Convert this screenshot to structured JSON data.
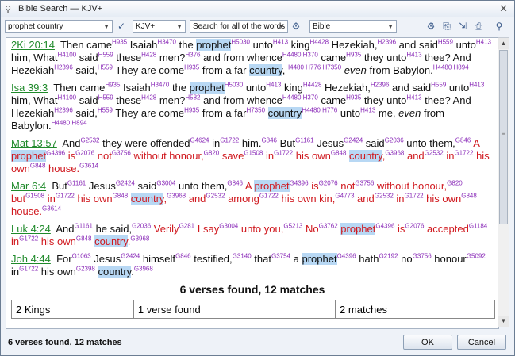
{
  "window": {
    "title": "Bible Search — KJV+",
    "title_icon": "binoculars-icon",
    "close_glyph": "✕"
  },
  "toolbar": {
    "search_value": "prophet country",
    "spell_icon": "spellcheck-icon",
    "version_value": "KJV+",
    "mode_value": "Search for all of the words",
    "options_icon": "gear-icon",
    "scope_value": "Bible"
  },
  "verses": [
    {
      "ref": "2Ki 20:14",
      "parts": [
        [
          "t",
          "Then came"
        ],
        [
          "s",
          "H935"
        ],
        [
          "t",
          " Isaiah"
        ],
        [
          "s",
          "H3470"
        ],
        [
          "t",
          " the "
        ],
        [
          "h",
          "prophet"
        ],
        [
          "s",
          "H5030"
        ],
        [
          "t",
          " unto"
        ],
        [
          "s",
          "H413"
        ],
        [
          "t",
          " king"
        ],
        [
          "s",
          "H4428"
        ],
        [
          "t",
          " Hezekiah,"
        ],
        [
          "s",
          "H2396"
        ],
        [
          "t",
          " and said"
        ],
        [
          "s",
          "H559"
        ],
        [
          "t",
          " unto"
        ],
        [
          "s",
          "H413"
        ],
        [
          "t",
          " him, What"
        ],
        [
          "s",
          "H4100"
        ],
        [
          "t",
          " said"
        ],
        [
          "s",
          "H559"
        ],
        [
          "t",
          " these"
        ],
        [
          "s",
          "H428"
        ],
        [
          "t",
          " men?"
        ],
        [
          "s",
          "H376"
        ],
        [
          "t",
          " and from whence"
        ],
        [
          "s",
          "H4480 H370"
        ],
        [
          "t",
          " came"
        ],
        [
          "s",
          "H935"
        ],
        [
          "t",
          " they unto"
        ],
        [
          "s",
          "H413"
        ],
        [
          "t",
          " thee? And Hezekiah"
        ],
        [
          "s",
          "H2396"
        ],
        [
          "t",
          " said,"
        ],
        [
          "s",
          "H559"
        ],
        [
          "t",
          " They are come"
        ],
        [
          "s",
          "H935"
        ],
        [
          "t",
          " from a far "
        ],
        [
          "h",
          "country"
        ],
        [
          "t",
          ","
        ],
        [
          "s",
          "H4480 H776 H7350"
        ],
        [
          "t",
          " "
        ],
        [
          "i",
          "even"
        ],
        [
          "t",
          " from Babylon."
        ],
        [
          "s",
          "H4480 H894"
        ]
      ]
    },
    {
      "ref": "Isa 39:3",
      "parts": [
        [
          "t",
          "Then came"
        ],
        [
          "s",
          "H935"
        ],
        [
          "t",
          " Isaiah"
        ],
        [
          "s",
          "H3470"
        ],
        [
          "t",
          " the "
        ],
        [
          "h",
          "prophet"
        ],
        [
          "s",
          "H5030"
        ],
        [
          "t",
          " unto"
        ],
        [
          "s",
          "H413"
        ],
        [
          "t",
          " king"
        ],
        [
          "s",
          "H4428"
        ],
        [
          "t",
          " Hezekiah,"
        ],
        [
          "s",
          "H2396"
        ],
        [
          "t",
          " and said"
        ],
        [
          "s",
          "H559"
        ],
        [
          "t",
          " unto"
        ],
        [
          "s",
          "H413"
        ],
        [
          "t",
          " him, What"
        ],
        [
          "s",
          "H4100"
        ],
        [
          "t",
          " said"
        ],
        [
          "s",
          "H559"
        ],
        [
          "t",
          " these"
        ],
        [
          "s",
          "H428"
        ],
        [
          "t",
          " men?"
        ],
        [
          "s",
          "H582"
        ],
        [
          "t",
          " and from whence"
        ],
        [
          "s",
          "H4480 H370"
        ],
        [
          "t",
          " came"
        ],
        [
          "s",
          "H935"
        ],
        [
          "t",
          " they unto"
        ],
        [
          "s",
          "H413"
        ],
        [
          "t",
          " thee? And Hezekiah"
        ],
        [
          "s",
          "H2396"
        ],
        [
          "t",
          " said,"
        ],
        [
          "s",
          "H559"
        ],
        [
          "t",
          " They are come"
        ],
        [
          "s",
          "H935"
        ],
        [
          "t",
          " from a far"
        ],
        [
          "s",
          "H7350"
        ],
        [
          "t",
          " "
        ],
        [
          "h",
          "country"
        ],
        [
          "s",
          "H4480 H776"
        ],
        [
          "t",
          " unto"
        ],
        [
          "s",
          "H413"
        ],
        [
          "t",
          " me, "
        ],
        [
          "i",
          "even"
        ],
        [
          "t",
          " from Babylon."
        ],
        [
          "s",
          "H4480 H894"
        ]
      ]
    },
    {
      "ref": "Mat 13:57",
      "parts": [
        [
          "t",
          "And"
        ],
        [
          "s",
          "G2532"
        ],
        [
          "t",
          " they were offended"
        ],
        [
          "s",
          "G4624"
        ],
        [
          "t",
          " in"
        ],
        [
          "s",
          "G1722"
        ],
        [
          "t",
          " him."
        ],
        [
          "s",
          "G846"
        ],
        [
          "t",
          " But"
        ],
        [
          "s",
          "G1161"
        ],
        [
          "t",
          " Jesus"
        ],
        [
          "s",
          "G2424"
        ],
        [
          "t",
          " said"
        ],
        [
          "s",
          "G2036"
        ],
        [
          "t",
          " unto them,"
        ],
        [
          "s",
          "G846"
        ],
        [
          "r",
          " A "
        ],
        [
          "rh",
          "prophet"
        ],
        [
          "s",
          "G4396"
        ],
        [
          "r",
          " is"
        ],
        [
          "s",
          "G2076"
        ],
        [
          "r",
          " not"
        ],
        [
          "s",
          "G3756"
        ],
        [
          "r",
          " without honour,"
        ],
        [
          "s",
          "G820"
        ],
        [
          "r",
          " save"
        ],
        [
          "s",
          "G1508"
        ],
        [
          "r",
          " in"
        ],
        [
          "s",
          "G1722"
        ],
        [
          "r",
          " his own"
        ],
        [
          "s",
          "G848"
        ],
        [
          "r",
          " "
        ],
        [
          "rh",
          "country"
        ],
        [
          "r",
          ","
        ],
        [
          "s",
          "G3968"
        ],
        [
          "r",
          " and"
        ],
        [
          "s",
          "G2532"
        ],
        [
          "r",
          " in"
        ],
        [
          "s",
          "G1722"
        ],
        [
          "r",
          " his own"
        ],
        [
          "s",
          "G848"
        ],
        [
          "r",
          " house."
        ],
        [
          "s",
          "G3614"
        ]
      ]
    },
    {
      "ref": "Mar 6:4",
      "parts": [
        [
          "t",
          "But"
        ],
        [
          "s",
          "G1161"
        ],
        [
          "t",
          " Jesus"
        ],
        [
          "s",
          "G2424"
        ],
        [
          "t",
          " said"
        ],
        [
          "s",
          "G3004"
        ],
        [
          "t",
          " unto them,"
        ],
        [
          "s",
          "G846"
        ],
        [
          "r",
          " A "
        ],
        [
          "rh",
          "prophet"
        ],
        [
          "s",
          "G4396"
        ],
        [
          "r",
          " is"
        ],
        [
          "s",
          "G2076"
        ],
        [
          "r",
          " not"
        ],
        [
          "s",
          "G3756"
        ],
        [
          "r",
          " without honour,"
        ],
        [
          "s",
          "G820"
        ],
        [
          "r",
          " but"
        ],
        [
          "s",
          "G1508"
        ],
        [
          "r",
          " in"
        ],
        [
          "s",
          "G1722"
        ],
        [
          "r",
          " his own"
        ],
        [
          "s",
          "G848"
        ],
        [
          "r",
          " "
        ],
        [
          "rh",
          "country"
        ],
        [
          "r",
          ","
        ],
        [
          "s",
          "G3968"
        ],
        [
          "r",
          " and"
        ],
        [
          "s",
          "G2532"
        ],
        [
          "r",
          " among"
        ],
        [
          "s",
          "G1722"
        ],
        [
          "r",
          " his own kin,"
        ],
        [
          "s",
          "G4773"
        ],
        [
          "r",
          " and"
        ],
        [
          "s",
          "G2532"
        ],
        [
          "r",
          " in"
        ],
        [
          "s",
          "G1722"
        ],
        [
          "r",
          " his own"
        ],
        [
          "s",
          "G848"
        ],
        [
          "r",
          " house."
        ],
        [
          "s",
          "G3614"
        ]
      ]
    },
    {
      "ref": "Luk 4:24",
      "parts": [
        [
          "t",
          "And"
        ],
        [
          "s",
          "G1161"
        ],
        [
          "t",
          " he said,"
        ],
        [
          "s",
          "G2036"
        ],
        [
          "r",
          " Verily"
        ],
        [
          "s",
          "G281"
        ],
        [
          "r",
          " I say"
        ],
        [
          "s",
          "G3004"
        ],
        [
          "r",
          " unto you,"
        ],
        [
          "s",
          "G5213"
        ],
        [
          "r",
          " No"
        ],
        [
          "s",
          "G3762"
        ],
        [
          "r",
          " "
        ],
        [
          "rh",
          "prophet"
        ],
        [
          "s",
          "G4396"
        ],
        [
          "r",
          " is"
        ],
        [
          "s",
          "G2076"
        ],
        [
          "r",
          " accepted"
        ],
        [
          "s",
          "G1184"
        ],
        [
          "r",
          " in"
        ],
        [
          "s",
          "G1722"
        ],
        [
          "r",
          " his own"
        ],
        [
          "s",
          "G848"
        ],
        [
          "r",
          " "
        ],
        [
          "rh",
          "country"
        ],
        [
          "r",
          "."
        ],
        [
          "s",
          "G3968"
        ]
      ]
    },
    {
      "ref": "Joh 4:44",
      "parts": [
        [
          "t",
          "For"
        ],
        [
          "s",
          "G1063"
        ],
        [
          "t",
          " Jesus"
        ],
        [
          "s",
          "G2424"
        ],
        [
          "t",
          " himself"
        ],
        [
          "s",
          "G846"
        ],
        [
          "t",
          " testified,"
        ],
        [
          "s",
          "G3140"
        ],
        [
          "t",
          " that"
        ],
        [
          "s",
          "G3754"
        ],
        [
          "t",
          " a "
        ],
        [
          "h",
          "prophet"
        ],
        [
          "s",
          "G4396"
        ],
        [
          "t",
          " hath"
        ],
        [
          "s",
          "G2192"
        ],
        [
          "t",
          " no"
        ],
        [
          "s",
          "G3756"
        ],
        [
          "t",
          " honour"
        ],
        [
          "s",
          "G5092"
        ],
        [
          "t",
          " in"
        ],
        [
          "s",
          "G1722"
        ],
        [
          "t",
          " his own"
        ],
        [
          "s",
          "G2398"
        ],
        [
          "t",
          " "
        ],
        [
          "h",
          "country"
        ],
        [
          "t",
          "."
        ],
        [
          "s",
          "G3968"
        ]
      ]
    }
  ],
  "summary": {
    "heading": "6 verses found, 12 matches",
    "rows": [
      [
        "2 Kings",
        "1 verse found",
        "2 matches"
      ]
    ]
  },
  "status": {
    "text": "6 verses found, 12 matches"
  },
  "buttons": {
    "ok": "OK",
    "cancel": "Cancel"
  }
}
